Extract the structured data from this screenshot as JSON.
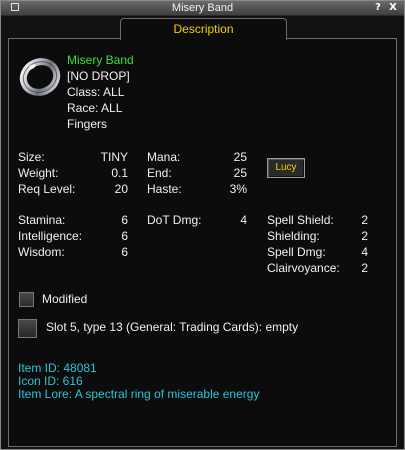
{
  "window": {
    "title": "Misery Band",
    "help_label": "?",
    "close_label": "X"
  },
  "tab": {
    "label": "Description"
  },
  "item": {
    "icon": "ring-icon",
    "name": "Misery Band",
    "flag": "[NO DROP]",
    "class": "Class:  ALL",
    "race": "Race:  ALL",
    "slot": "Fingers"
  },
  "stats": {
    "size_label": "Size:",
    "size_value": "TINY",
    "weight_label": "Weight:",
    "weight_value": "0.1",
    "reqlevel_label": "Req Level:",
    "reqlevel_value": "20",
    "mana_label": "Mana:",
    "mana_value": "25",
    "end_label": "End:",
    "end_value": "25",
    "haste_label": "Haste:",
    "haste_value": "3%"
  },
  "lucy_button": "Lucy",
  "attributes": {
    "stamina_label": "Stamina:",
    "stamina_value": "6",
    "intelligence_label": "Intelligence:",
    "intelligence_value": "6",
    "wisdom_label": "Wisdom:",
    "wisdom_value": "6",
    "dot_label": "DoT Dmg:",
    "dot_value": "4",
    "spellshield_label": "Spell Shield:",
    "spellshield_value": "2",
    "shielding_label": "Shielding:",
    "shielding_value": "2",
    "spelldmg_label": "Spell Dmg:",
    "spelldmg_value": "4",
    "clairvoyance_label": "Clairvoyance:",
    "clairvoyance_value": "2"
  },
  "modified_label": "Modified",
  "augment_slot": "Slot 5, type 13 (General: Trading Cards): empty",
  "info": {
    "item_id": "Item ID: 48081",
    "icon_id": "Icon ID: 616",
    "lore": "Item Lore: A spectral ring of miserable energy"
  },
  "colors": {
    "item_name": "#3ddc3d",
    "tab_label": "#f5d000",
    "info_text": "#29c6d6"
  }
}
